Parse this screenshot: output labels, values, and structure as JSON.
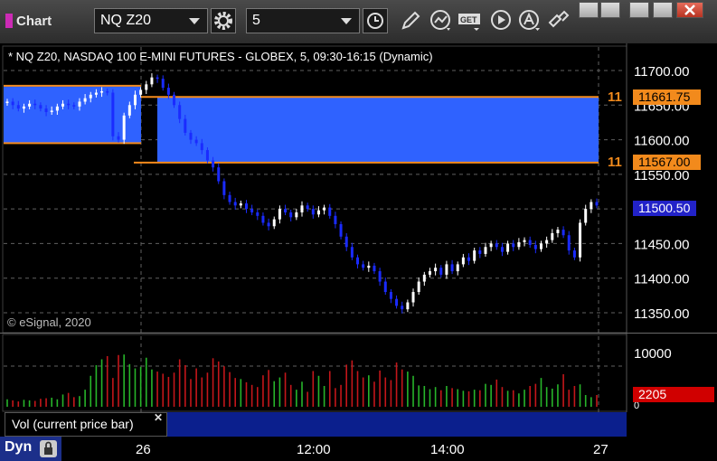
{
  "toolbar": {
    "title": "Chart",
    "symbol": "NQ Z20",
    "interval": "5",
    "tag_button": "GET"
  },
  "chart_info": "* NQ Z20, NASDAQ 100 E-MINI FUTURES - GLOBEX, 5, 09:30-16:15 (Dynamic)",
  "copyright": "© eSignal, 2020",
  "tags": {
    "upper_prefix": "11",
    "upper_value": "11661.75",
    "lower_prefix": "11",
    "lower_value": "11567.00",
    "last_price": "11500.50",
    "last_volume": "2205"
  },
  "volume_axis": {
    "top": "10000",
    "bottom": "0"
  },
  "volume_study": "Vol (current price bar)",
  "bottom_bar": {
    "mode": "Dyn"
  },
  "colors": {
    "zone": "#2f62ff",
    "zone_line": "#f28a1c",
    "up_bar": "#ffffff",
    "down_bar": "#1a2bff",
    "vol_up": "#27b52a",
    "vol_down": "#c4161a"
  },
  "chart_data": {
    "type": "candlestick",
    "y_ticks": [
      "11700.00",
      "11650.00",
      "11600.00",
      "11550.00",
      "11500.00",
      "11450.00",
      "11400.00",
      "11350.00"
    ],
    "x_ticks": [
      "26",
      "12:00",
      "14:00",
      "27"
    ],
    "ylim": [
      11325,
      11725
    ],
    "zones": [
      {
        "from": 11595,
        "to": 11678
      },
      {
        "from": 11567,
        "to": 11661.75
      }
    ],
    "close_path": [
      11655,
      11650,
      11645,
      11648,
      11652,
      11650,
      11645,
      11640,
      11642,
      11648,
      11652,
      11650,
      11648,
      11655,
      11660,
      11665,
      11668,
      11670,
      11668,
      11605,
      11600,
      11635,
      11650,
      11665,
      11672,
      11680,
      11690,
      11688,
      11675,
      11665,
      11650,
      11630,
      11610,
      11600,
      11595,
      11585,
      11570,
      11560,
      11540,
      11520,
      11510,
      11505,
      11508,
      11500,
      11495,
      11490,
      11480,
      11475,
      11485,
      11500,
      11495,
      11488,
      11495,
      11505,
      11500,
      11492,
      11498,
      11502,
      11490,
      11478,
      11460,
      11445,
      11430,
      11420,
      11415,
      11418,
      11410,
      11395,
      11380,
      11370,
      11360,
      11355,
      11365,
      11380,
      11395,
      11405,
      11410,
      11415,
      11405,
      11420,
      11410,
      11420,
      11430,
      11425,
      11440,
      11435,
      11445,
      11450,
      11445,
      11438,
      11450,
      11445,
      11452,
      11455,
      11448,
      11442,
      11450,
      11455,
      11465,
      11470,
      11462,
      11440,
      11430,
      11480,
      11500,
      11510,
      11505
    ],
    "volume": [
      1400,
      1200,
      1000,
      1300,
      1200,
      1100,
      1500,
      1600,
      1700,
      1400,
      2300,
      2600,
      1800,
      2000,
      3200,
      5800,
      7800,
      8900,
      9500,
      5400,
      9700,
      9800,
      8000,
      7200,
      7500,
      9200,
      7000,
      6600,
      6200,
      5600,
      6400,
      8900,
      7800,
      5200,
      7200,
      5500,
      6400,
      9100,
      8500,
      7600,
      6500,
      5400,
      5200,
      4600,
      4100,
      3700,
      5900,
      6900,
      4800,
      5500,
      6400,
      4100,
      3200,
      4700,
      2800,
      6700,
      5800,
      3900,
      6700,
      3500,
      4100,
      7900,
      8700,
      6700,
      5500,
      5900,
      4700,
      6800,
      5500,
      5000,
      8300,
      7000,
      6600,
      5800,
      4000,
      3900,
      3300,
      3700,
      3100,
      3900,
      3500,
      3300,
      3000,
      2900,
      3200,
      3100,
      4300,
      4100,
      5100,
      3700,
      3000,
      3100,
      2500,
      3200,
      3900,
      4300,
      5400,
      3700,
      3400,
      4200,
      6100,
      3200,
      3900,
      4200,
      2200,
      1800,
      2205
    ]
  }
}
